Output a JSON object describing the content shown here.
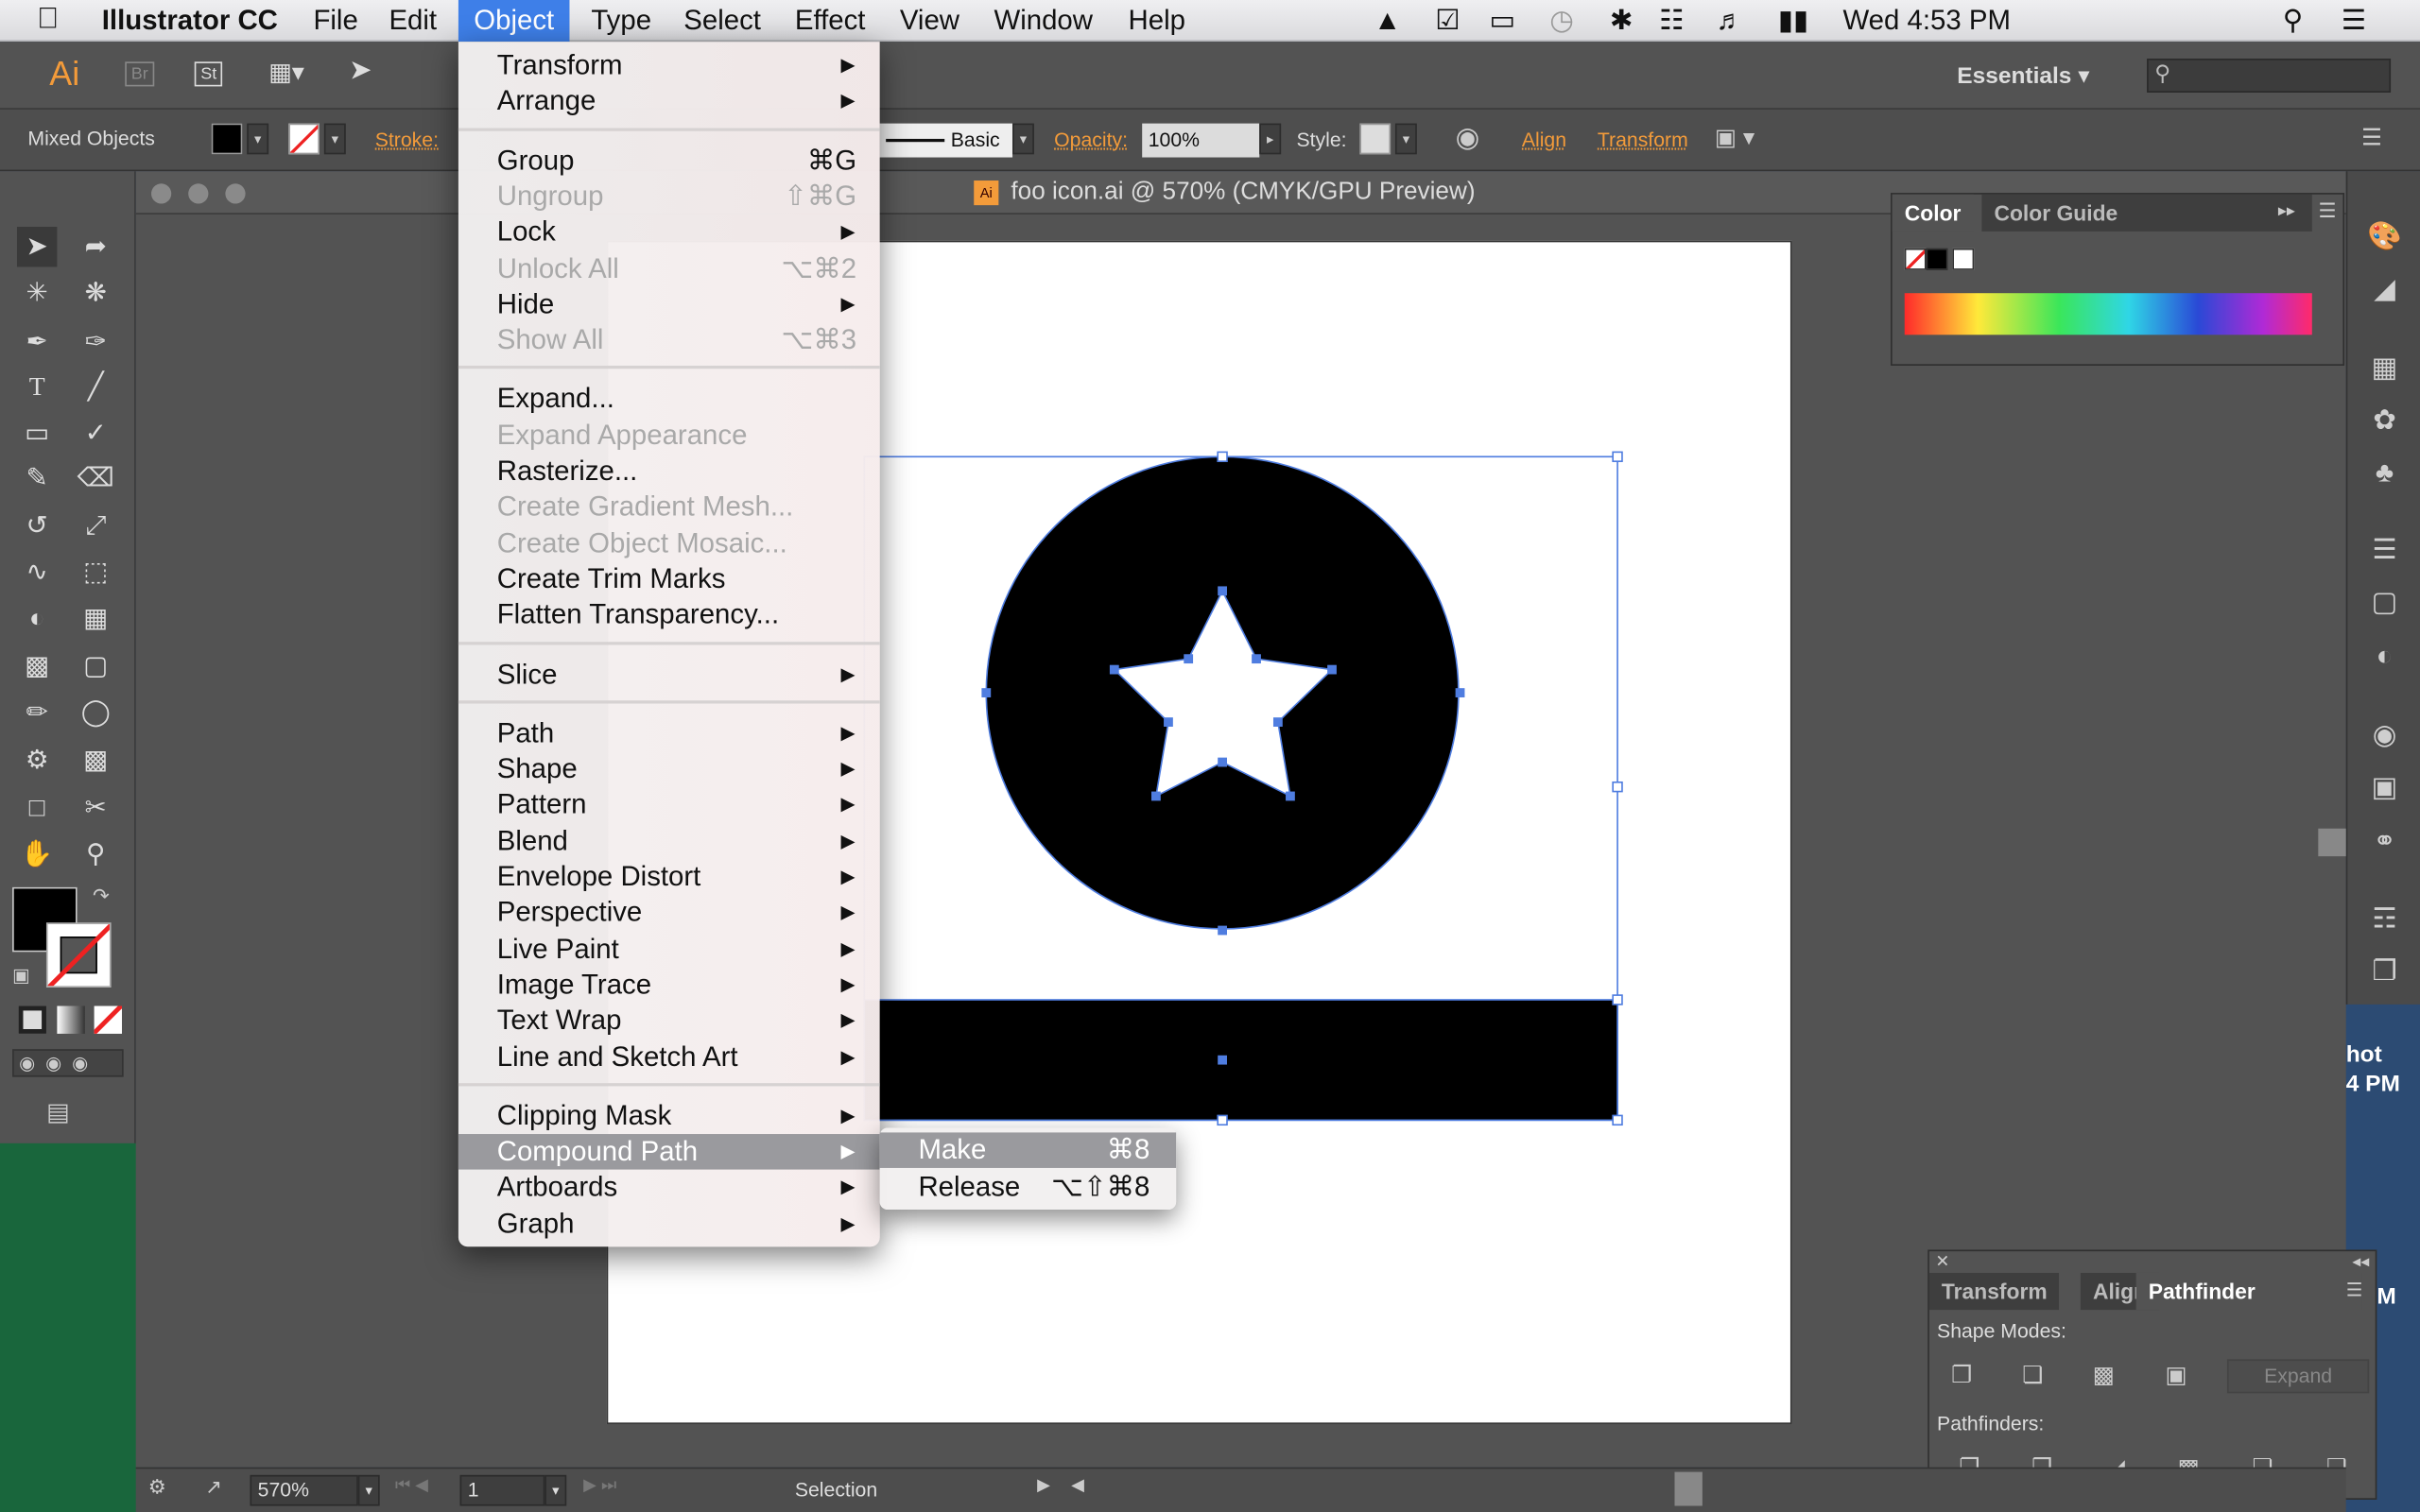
{
  "menubar": {
    "app_name": "Illustrator CC",
    "items": [
      "File",
      "Edit",
      "Object",
      "Type",
      "Select",
      "Effect",
      "View",
      "Window",
      "Help"
    ],
    "clock": "Wed 4:53 PM"
  },
  "appbar": {
    "logo": "Ai",
    "br": "Br",
    "st": "St",
    "workspace": "Essentials"
  },
  "control_bar": {
    "selection_label": "Mixed Objects",
    "stroke_label": "Stroke:",
    "brush_label": "Basic",
    "opacity_label": "Opacity:",
    "opacity_value": "100%",
    "style_label": "Style:",
    "align_label": "Align",
    "transform_label": "Transform"
  },
  "document": {
    "title": "foo icon.ai @ 570% (CMYK/GPU Preview)"
  },
  "object_menu": {
    "items": [
      {
        "label": "Transform",
        "submenu": true
      },
      {
        "label": "Arrange",
        "submenu": true
      },
      {
        "sep": true
      },
      {
        "label": "Group",
        "shortcut": "⌘G"
      },
      {
        "label": "Ungroup",
        "shortcut": "⇧⌘G",
        "disabled": true
      },
      {
        "label": "Lock",
        "submenu": true
      },
      {
        "label": "Unlock All",
        "shortcut": "⌥⌘2",
        "disabled": true
      },
      {
        "label": "Hide",
        "submenu": true
      },
      {
        "label": "Show All",
        "shortcut": "⌥⌘3",
        "disabled": true
      },
      {
        "sep": true
      },
      {
        "label": "Expand..."
      },
      {
        "label": "Expand Appearance",
        "disabled": true
      },
      {
        "label": "Rasterize..."
      },
      {
        "label": "Create Gradient Mesh...",
        "disabled": true
      },
      {
        "label": "Create Object Mosaic...",
        "disabled": true
      },
      {
        "label": "Create Trim Marks"
      },
      {
        "label": "Flatten Transparency..."
      },
      {
        "sep": true
      },
      {
        "label": "Slice",
        "submenu": true
      },
      {
        "sep": true
      },
      {
        "label": "Path",
        "submenu": true
      },
      {
        "label": "Shape",
        "submenu": true
      },
      {
        "label": "Pattern",
        "submenu": true
      },
      {
        "label": "Blend",
        "submenu": true
      },
      {
        "label": "Envelope Distort",
        "submenu": true
      },
      {
        "label": "Perspective",
        "submenu": true
      },
      {
        "label": "Live Paint",
        "submenu": true
      },
      {
        "label": "Image Trace",
        "submenu": true
      },
      {
        "label": "Text Wrap",
        "submenu": true
      },
      {
        "label": "Line and Sketch Art",
        "submenu": true
      },
      {
        "sep": true
      },
      {
        "label": "Clipping Mask",
        "submenu": true
      },
      {
        "label": "Compound Path",
        "submenu": true,
        "highlighted": true
      },
      {
        "label": "Artboards",
        "submenu": true
      },
      {
        "label": "Graph",
        "submenu": true
      }
    ]
  },
  "compound_submenu": {
    "items": [
      {
        "label": "Make",
        "shortcut": "⌘8",
        "highlighted": true
      },
      {
        "label": "Release",
        "shortcut": "⌥⇧⌘8"
      }
    ]
  },
  "color_panel": {
    "tab_color": "Color",
    "tab_guide": "Color Guide"
  },
  "pathfinder_panel": {
    "tab_transform": "Transform",
    "tab_align": "Align",
    "tab_pathfinder": "Pathfinder",
    "shape_modes": "Shape Modes:",
    "expand": "Expand",
    "pathfinders": "Pathfinders:"
  },
  "status_bar": {
    "zoom": "570%",
    "artboard_num": "1",
    "tool": "Selection"
  },
  "desktop": {
    "text_line1": "hot",
    "text_line2": "4 PM",
    "text_line3": "M"
  }
}
